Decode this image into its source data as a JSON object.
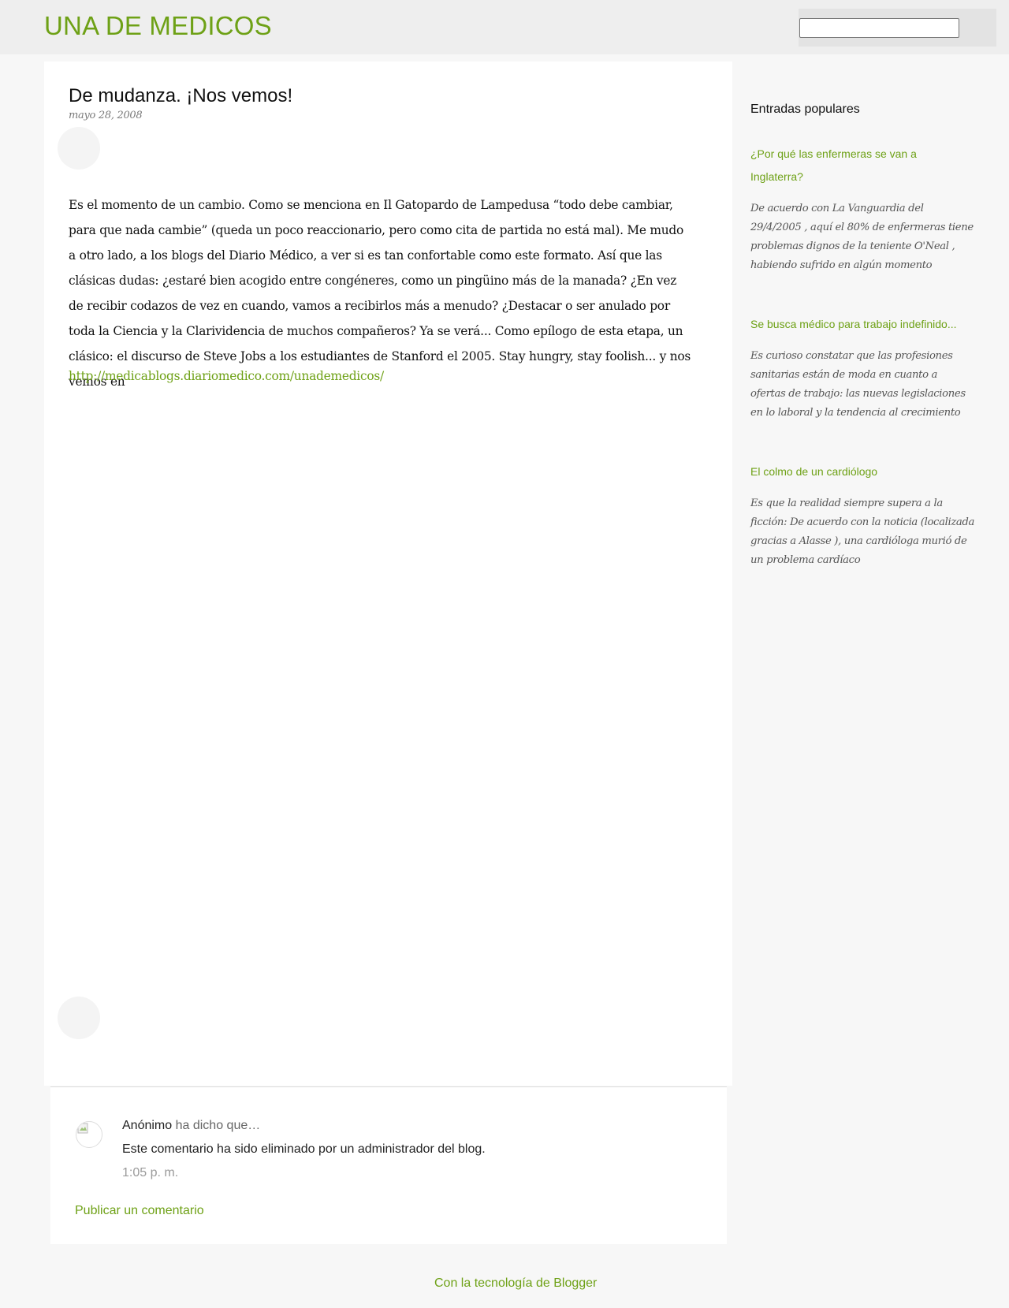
{
  "header": {
    "blog_title": "UNA DE MEDICOS",
    "search": {
      "value": "",
      "placeholder": ""
    }
  },
  "post": {
    "title": "De mudanza. ¡Nos vemos!",
    "date": "mayo 28, 2008",
    "body": "Es el momento de un cambio. Como se menciona en Il Gatopardo de Lampedusa “todo debe cambiar, para que nada cambie” (queda un poco reaccionario, pero como cita de partida no está mal). Me mudo a otro lado, a los blogs del Diario Médico, a ver si es tan confortable como este formato. Así que las clásicas dudas: ¿estaré bien acogido entre congéneres, como un pingüino más de la manada? ¿En vez de recibir codazos de vez en cuando, vamos a recibirlos más a menudo? ¿Destacar o ser anulado por toda la Ciencia y la Clarividencia de muchos compañeros? Ya se verá... Como epílogo de esta etapa, un clásico: el discurso de Steve Jobs a los estudiantes de Stanford el 2005. Stay hungry, stay foolish... y nos vemos en",
    "link": "http://medicablogs.diariomedico.com/unademedicos/"
  },
  "comments": {
    "items": [
      {
        "author": "Anónimo",
        "said": " ha dicho que…",
        "text": "Este comentario ha sido eliminado por un administrador del blog.",
        "time": "1:05 p. m."
      }
    ],
    "publish_label": "Publicar un comentario"
  },
  "sidebar": {
    "title": "Entradas populares",
    "posts": [
      {
        "title": "¿Por qué las enfermeras se van a Inglaterra?",
        "snippet": "De acuerdo con La Vanguardia del 29/4/2005 , aquí el 80% de enfermeras tiene problemas dignos de la teniente O'Neal , habiendo sufrido en algún momento"
      },
      {
        "title": "Se busca médico para trabajo indefinido...",
        "snippet": "Es curioso constatar que las profesiones sanitarias están de moda en cuanto a ofertas de trabajo: las nuevas legislaciones en lo laboral y la tendencia al crecimiento"
      },
      {
        "title": "El colmo de un cardiólogo",
        "snippet": "Es que la realidad siempre supera a la ficción: De acuerdo con la noticia (localizada gracias a Alasse ), una cardióloga murió de un problema cardíaco"
      }
    ]
  },
  "footer": {
    "powered_by": "Con la tecnología de Blogger"
  },
  "colors": {
    "accent": "#6ea116",
    "background": "#f7f7f7",
    "header_bg": "#eeeeee"
  },
  "icons": {
    "share_top": "share-icon",
    "share_bottom": "share-icon",
    "comment_avatar": "broken-image-icon"
  }
}
